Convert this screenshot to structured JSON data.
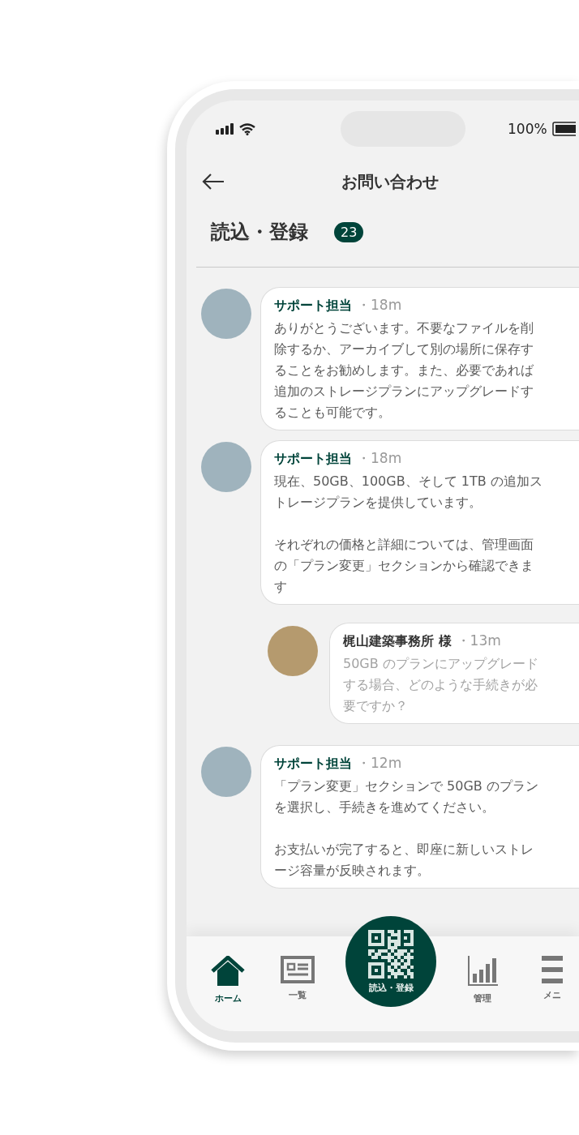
{
  "status_bar": {
    "battery": "100%"
  },
  "header": {
    "title": "お問い合わせ"
  },
  "section": {
    "title": "読込・登録",
    "badge": "23"
  },
  "messages": [
    {
      "kind": "support",
      "sender": "サポート担当",
      "time": "・18m",
      "body": [
        "ありがとうございます。不要なファイルを削除するか、アーカイブして別の場所に保存することをお勧めします。また、必要であれば追加のストレージプランにアップグレードすることも可能です。"
      ]
    },
    {
      "kind": "support",
      "sender": "サポート担当",
      "time": "・18m",
      "body": [
        "現在、50GB、100GB、そして 1TB の追加ストレージプランを提供しています。",
        "それぞれの価格と詳細については、管理画面の「プラン変更」セクションから確認できます"
      ]
    },
    {
      "kind": "customer",
      "sender": "梶山建築事務所 様",
      "time": "・13m",
      "body": [
        "50GB のプランにアップグレードする場合、どのような手続きが必要ですか？"
      ]
    },
    {
      "kind": "support",
      "sender": "サポート担当",
      "time": "・12m",
      "body": [
        "「プラン変更」セクションで 50GB のプランを選択し、手続きを進めてください。",
        "お支払いが完了すると、即座に新しいストレージ容量が反映されます。"
      ]
    }
  ],
  "nav": [
    {
      "kind": "home",
      "label": "ホーム",
      "selected": true
    },
    {
      "kind": "list",
      "label": "一覧",
      "selected": false
    },
    {
      "kind": "scan",
      "label": "読込・登録",
      "selected": false
    },
    {
      "kind": "chart",
      "label": "管理",
      "selected": false
    },
    {
      "kind": "menu",
      "label": "メニ",
      "selected": false
    }
  ]
}
